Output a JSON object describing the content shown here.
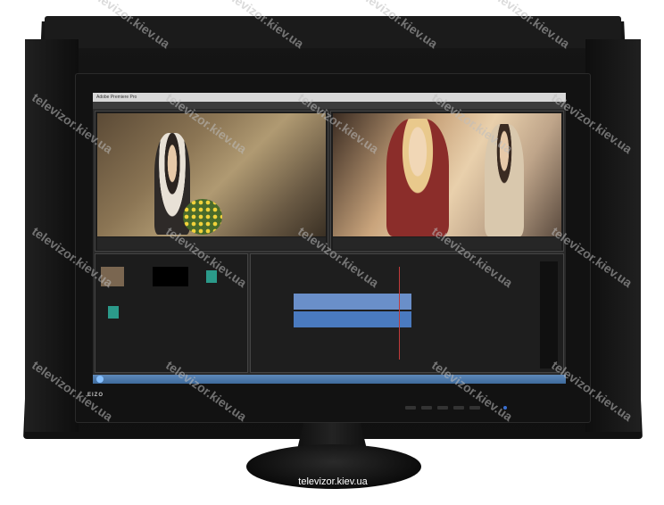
{
  "monitor": {
    "brand_logo": "EIZO",
    "screen_window_title": "Adobe Premiere Pro"
  },
  "caption": "televizor.kiev.ua",
  "watermark_text": "televizor.kiev.ua",
  "colors": {
    "hood": "#161616",
    "screen_bg": "#2a2a2a",
    "video_clip": "#6a8fc9",
    "audio_clip": "#4a7abf",
    "power_led": "#3a6fd1"
  }
}
